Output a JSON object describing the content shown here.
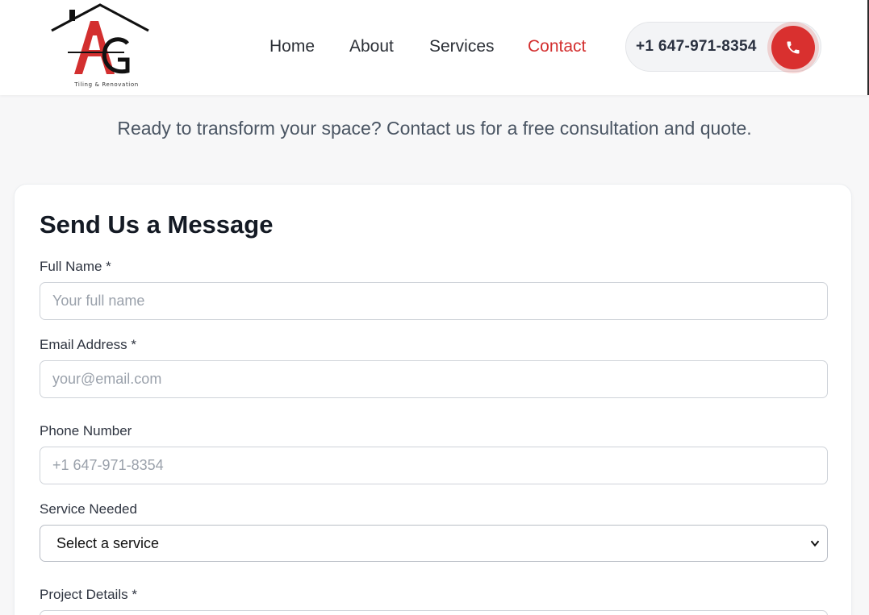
{
  "header": {
    "logo": {
      "letters": "AG",
      "amp": "&",
      "tagline": "Tiling & Renovation"
    },
    "nav": [
      {
        "label": "Home",
        "active": false
      },
      {
        "label": "About",
        "active": false
      },
      {
        "label": "Services",
        "active": false
      },
      {
        "label": "Contact",
        "active": true
      }
    ],
    "phone": {
      "number": "+1 647-971-8354",
      "icon": "phone-icon"
    }
  },
  "intro": {
    "text": "Ready to transform your space? Contact us for a free consultation and quote."
  },
  "form": {
    "title": "Send Us a Message",
    "full_name": {
      "label": "Full Name *",
      "placeholder": "Your full name"
    },
    "email": {
      "label": "Email Address *",
      "placeholder": "your@email.com"
    },
    "phone": {
      "label": "Phone Number",
      "placeholder": "+1 647-971-8354"
    },
    "service": {
      "label": "Service Needed",
      "selected": "Select a service"
    },
    "details": {
      "label": "Project Details *"
    }
  },
  "colors": {
    "accent": "#d32f2f",
    "text": "#2b2f36",
    "background": "#f7f7f8"
  }
}
